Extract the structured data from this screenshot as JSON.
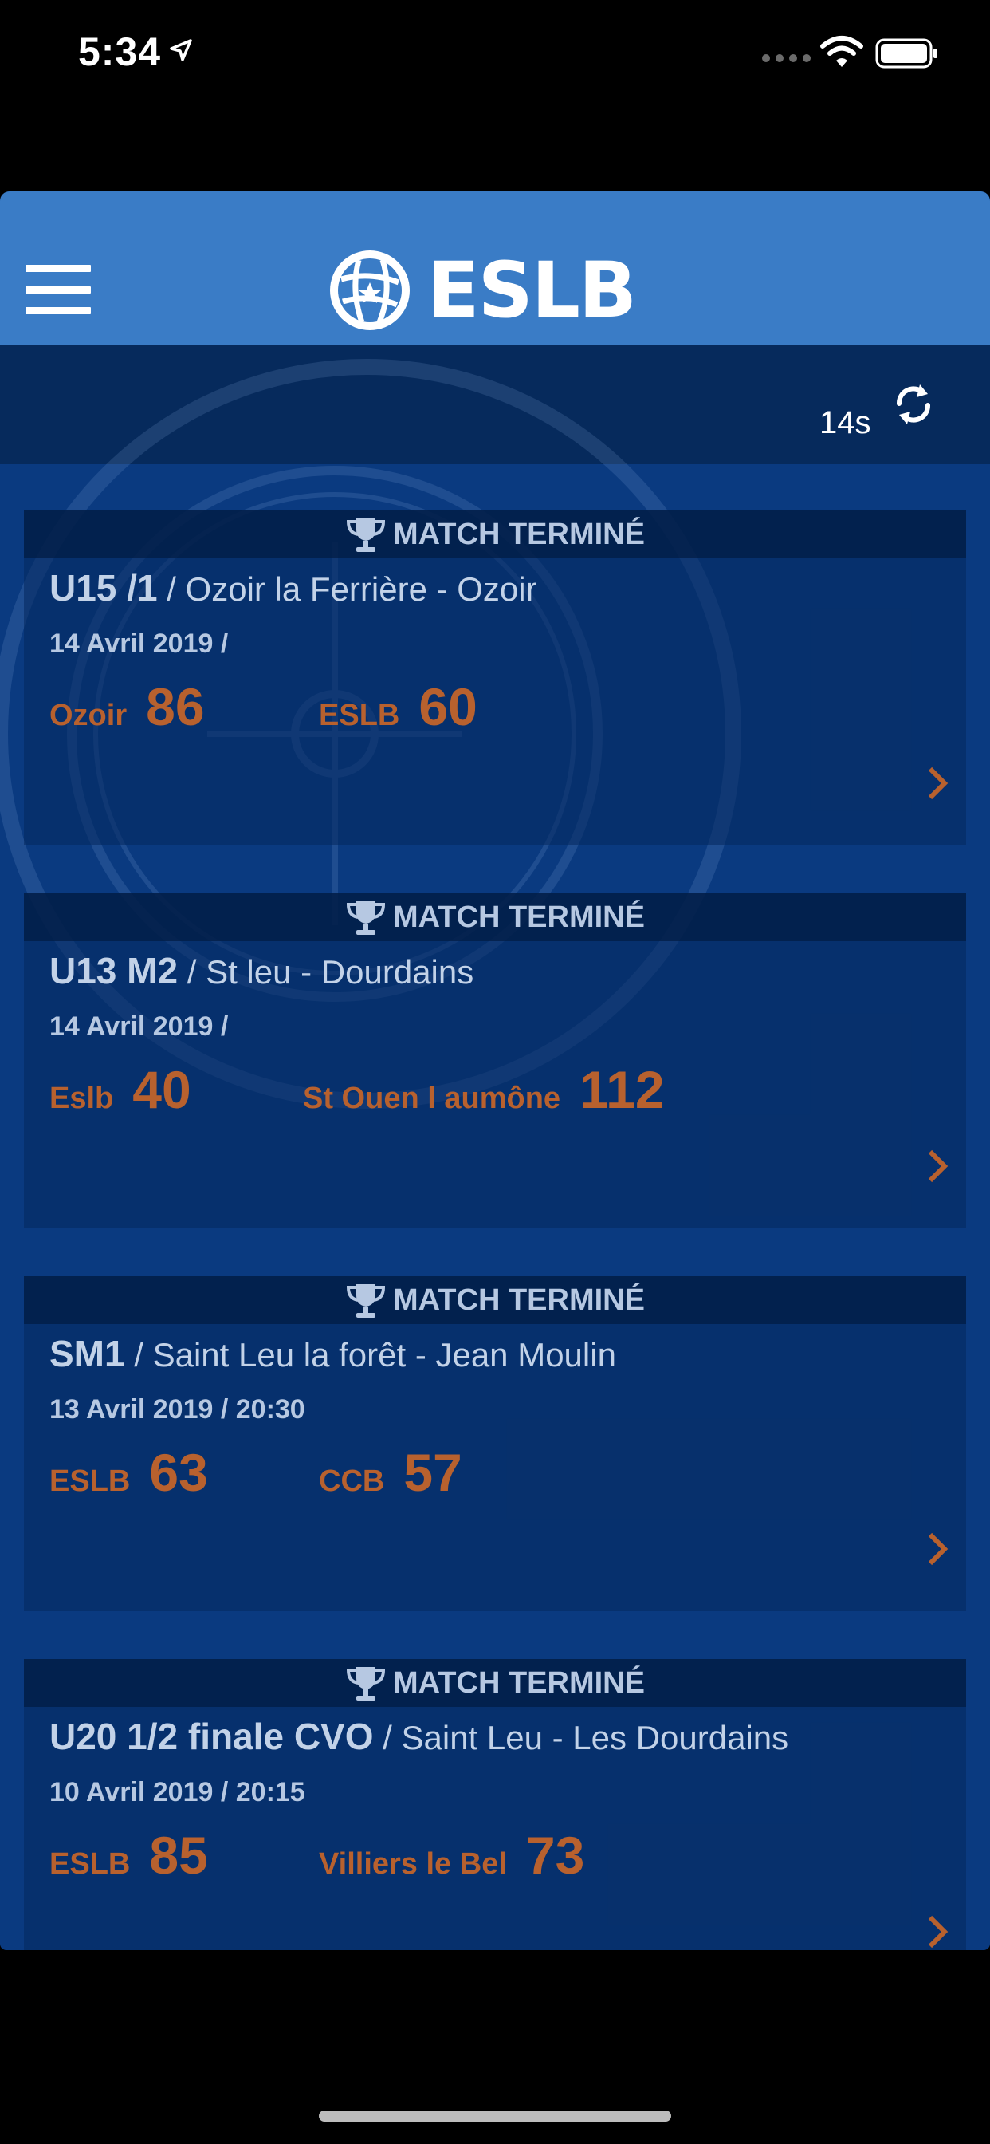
{
  "status_bar": {
    "time": "5:34"
  },
  "header": {
    "logo_text": "ESLB"
  },
  "refresh": {
    "countdown": "14s"
  },
  "matches": [
    {
      "status": "MATCH TERMINÉ",
      "category": "U15 /1",
      "venue": " / Ozoir la Ferrière - Ozoir",
      "date": "14 Avril 2019 /",
      "home_team": "Ozoir",
      "home_score": "86",
      "away_team": "ESLB",
      "away_score": "60"
    },
    {
      "status": "MATCH TERMINÉ",
      "category": "U13 M2",
      "venue": " / St leu - Dourdains",
      "date": "14 Avril 2019 /",
      "home_team": "Eslb",
      "home_score": "40",
      "away_team": "St Ouen l aumône",
      "away_score": "112"
    },
    {
      "status": "MATCH TERMINÉ",
      "category": "SM1",
      "venue": " / Saint Leu la forêt - Jean Moulin",
      "date": "13 Avril 2019 / 20:30",
      "home_team": "ESLB",
      "home_score": "63",
      "away_team": "CCB",
      "away_score": "57"
    },
    {
      "status": "MATCH TERMINÉ",
      "category": "U20 1/2 finale CVO",
      "venue": " / Saint Leu - Les Dourdains",
      "date": "10 Avril 2019 / 20:15",
      "home_team": "ESLB",
      "home_score": "85",
      "away_team": "Villiers le Bel",
      "away_score": "73"
    }
  ],
  "colors": {
    "header_blue": "#3a7cc6",
    "score_orange": "#b8612e",
    "background": "#0a3a80"
  },
  "icons": [
    "location-arrow-icon",
    "signal-icon",
    "wifi-icon",
    "battery-icon",
    "menu-icon",
    "eslb-logo-icon",
    "refresh-icon",
    "trophy-icon",
    "chevron-right-icon"
  ]
}
